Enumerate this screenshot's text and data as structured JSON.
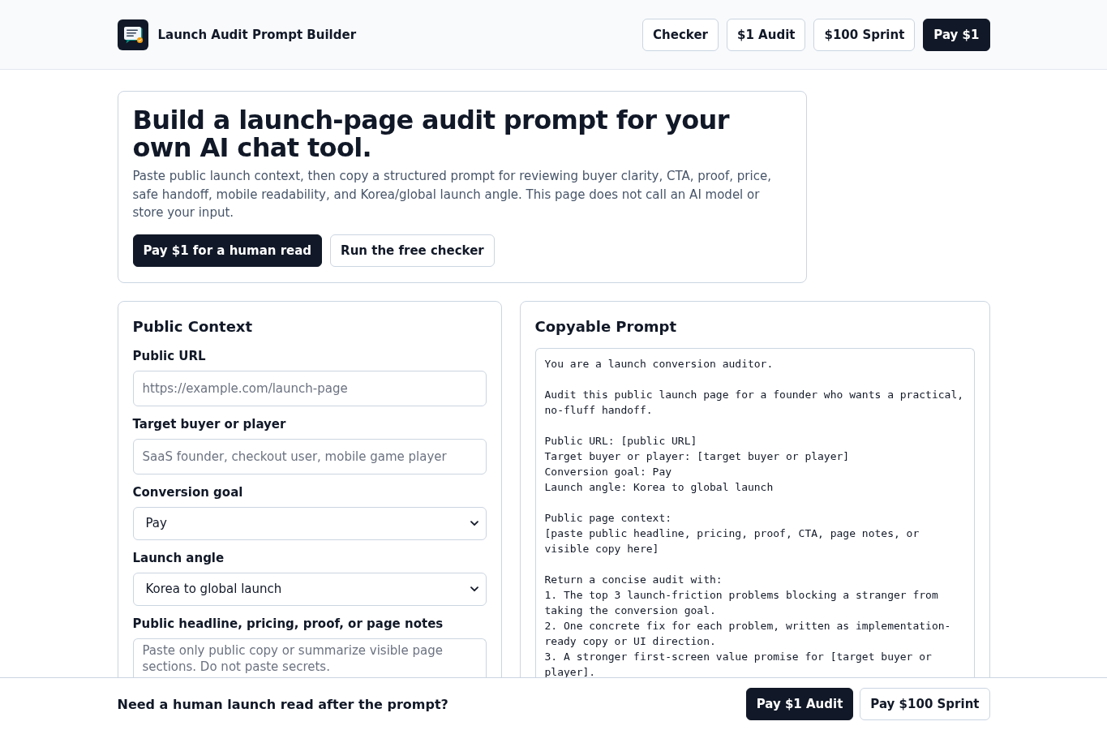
{
  "header": {
    "title": "Launch Audit Prompt Builder",
    "nav_buttons": [
      {
        "label": "Checker",
        "kind": "outline"
      },
      {
        "label": "$1 Audit",
        "kind": "outline"
      },
      {
        "label": "$100 Sprint",
        "kind": "outline"
      },
      {
        "label": "Pay $1",
        "kind": "primary"
      }
    ]
  },
  "hero": {
    "heading": "Build a launch-page audit prompt for your own AI chat tool.",
    "description": "Paste public launch context, then copy a structured prompt for reviewing buyer clarity, CTA, proof, price, safe handoff, mobile readability, and Korea/global launch angle. This page does not call an AI model or store your input.",
    "buttons": [
      {
        "label": "Pay $1 for a human read",
        "kind": "primary"
      },
      {
        "label": "Run the free checker",
        "kind": "outline"
      }
    ]
  },
  "public_context": {
    "title": "Public Context",
    "fields": [
      {
        "label": "Public URL",
        "kind": "input",
        "placeholder": "https://example.com/launch-page"
      },
      {
        "label": "Target buyer or player",
        "kind": "input",
        "placeholder": "SaaS founder, checkout user, mobile game player"
      },
      {
        "label": "Conversion goal",
        "kind": "select",
        "value": "Pay"
      },
      {
        "label": "Launch angle",
        "kind": "select",
        "value": "Korea to global launch"
      },
      {
        "label": "Public headline, pricing, proof, or page notes",
        "kind": "textarea",
        "placeholder": "Paste only public copy or summarize visible page sections. Do not paste secrets."
      }
    ]
  },
  "copyable_prompt": {
    "title": "Copyable Prompt",
    "text": "You are a launch conversion auditor.\n\nAudit this public launch page for a founder who wants a practical, no-fluff handoff.\n\nPublic URL: [public URL]\nTarget buyer or player: [target buyer or player]\nConversion goal: Pay\nLaunch angle: Korea to global launch\n\nPublic page context:\n[paste public headline, pricing, proof, CTA, page notes, or visible copy here]\n\nReturn a concise audit with:\n1. The top 3 launch-friction problems blocking a stranger from taking the conversion goal.\n2. One concrete fix for each problem, written as implementation-ready copy or UI direction.\n3. A stronger first-screen value promise for [target buyer or player]."
  },
  "bottom_bar": {
    "message": "Need a human launch read after the prompt?",
    "buttons": [
      {
        "label": "Pay $1 Audit",
        "kind": "primary"
      },
      {
        "label": "Pay $100 Sprint",
        "kind": "outline"
      }
    ]
  }
}
